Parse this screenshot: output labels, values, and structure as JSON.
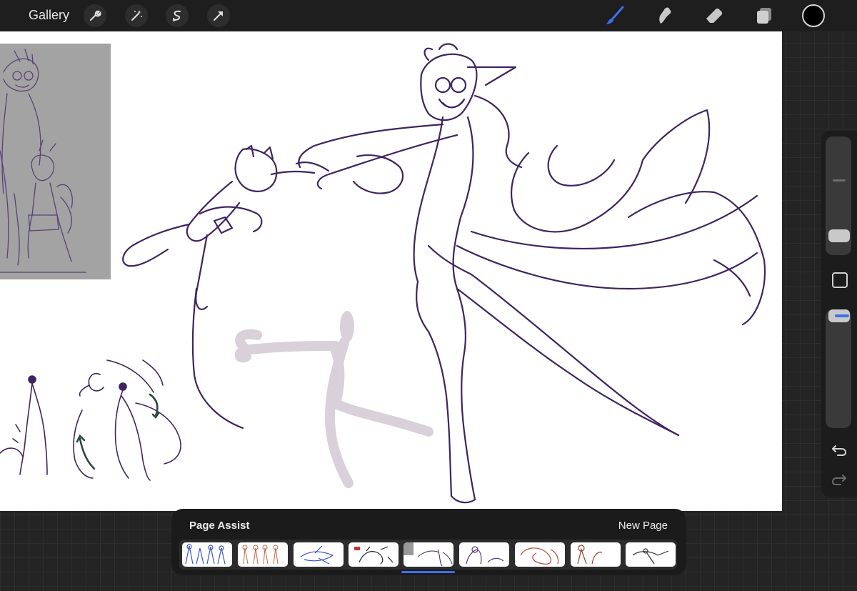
{
  "topbar": {
    "gallery_label": "Gallery",
    "left_tools": [
      {
        "name": "actions-wrench-icon"
      },
      {
        "name": "adjustments-wand-icon"
      },
      {
        "name": "selection-icon"
      },
      {
        "name": "transform-arrow-icon"
      }
    ],
    "right_tools": [
      {
        "name": "brush-icon",
        "active": true
      },
      {
        "name": "smudge-icon",
        "active": false
      },
      {
        "name": "eraser-icon",
        "active": false
      },
      {
        "name": "layers-icon",
        "active": false
      }
    ],
    "current_color": "#000000",
    "accent_color": "#3d6ff0"
  },
  "canvas": {
    "stroke_color": "#3e2460",
    "reference_bg": "#a3a3a3",
    "guide_color": "#d8ced9"
  },
  "sidebar": {
    "brush_size": 0.62,
    "opacity": 0.01,
    "modify_icon": "square-icon",
    "undo_icon": "undo-icon",
    "redo_icon": "redo-icon"
  },
  "page_assist": {
    "title": "Page Assist",
    "new_page_label": "New Page",
    "active_page": 5,
    "page_count": 9
  }
}
